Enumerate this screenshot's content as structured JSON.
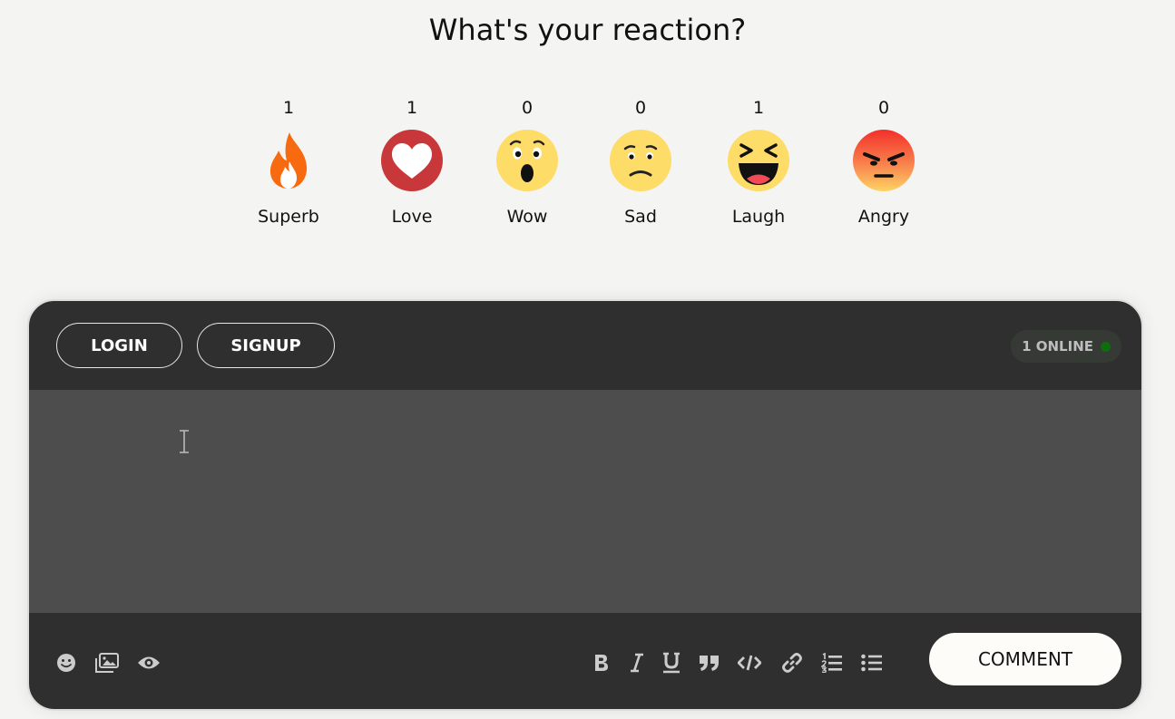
{
  "heading": "What's your reaction?",
  "reactions": [
    {
      "count": "1",
      "label": "Superb",
      "icon": "fire-icon"
    },
    {
      "count": "1",
      "label": "Love",
      "icon": "heart-icon"
    },
    {
      "count": "0",
      "label": "Wow",
      "icon": "wow-face-icon"
    },
    {
      "count": "0",
      "label": "Sad",
      "icon": "sad-face-icon"
    },
    {
      "count": "1",
      "label": "Laugh",
      "icon": "laugh-face-icon"
    },
    {
      "count": "0",
      "label": "Angry",
      "icon": "angry-face-icon"
    }
  ],
  "comments": {
    "login_label": "LOGIN",
    "signup_label": "SIGNUP",
    "online_text": "1 ONLINE",
    "online_color": "#0c6e0c",
    "comment_label": "COMMENT",
    "editor_placeholder": "",
    "left_tools": [
      "emoji-icon",
      "image-icon",
      "preview-eye-icon"
    ],
    "format_tools": [
      "bold-icon",
      "italic-icon",
      "underline-icon",
      "quote-icon",
      "code-icon",
      "link-icon",
      "ordered-list-icon",
      "unordered-list-icon"
    ]
  }
}
